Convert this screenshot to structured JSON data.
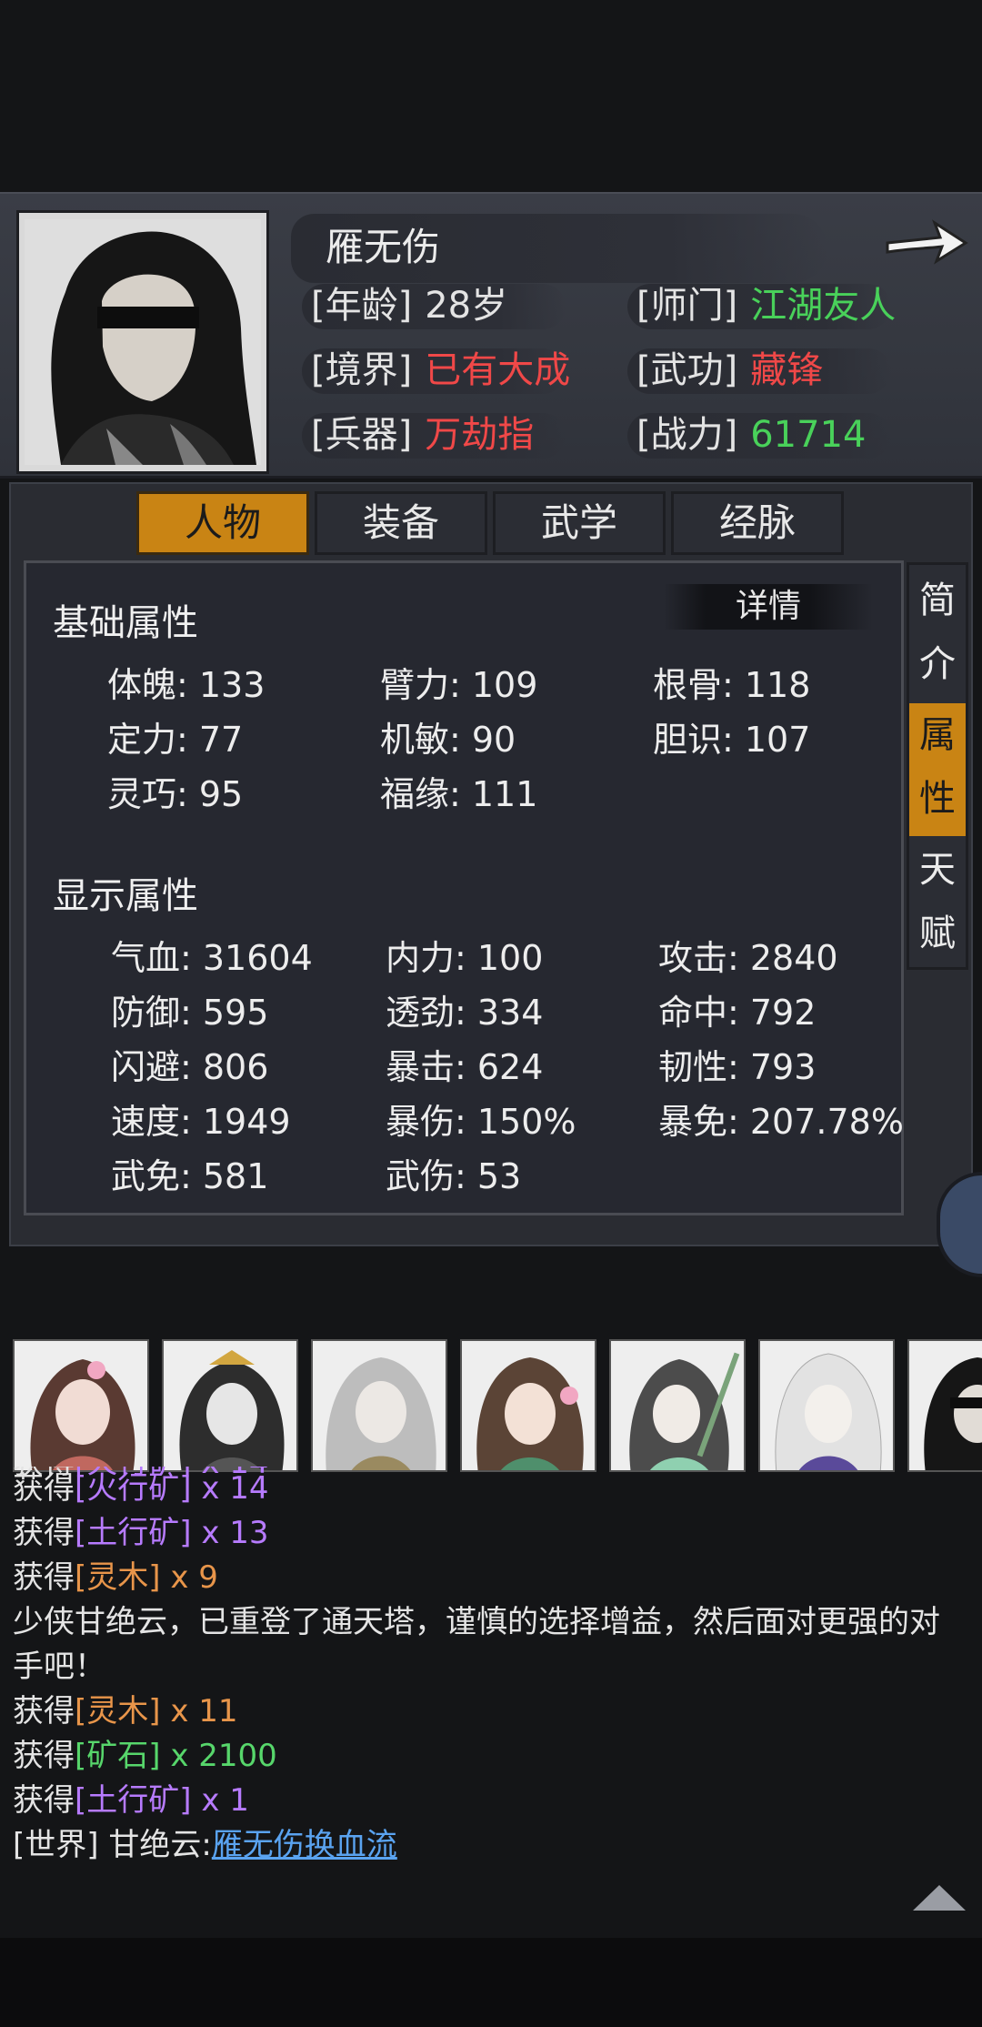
{
  "character": {
    "name": "雁无伤",
    "attributes": [
      {
        "key": "[年龄]",
        "value": "28岁",
        "color": "#e4e4e4"
      },
      {
        "key": "[师门]",
        "value": "江湖友人",
        "color": "#49d15a"
      },
      {
        "key": "[境界]",
        "value": "已有大成",
        "color": "#f04848"
      },
      {
        "key": "[武功]",
        "value": "藏锋",
        "color": "#f04848"
      },
      {
        "key": "[兵器]",
        "value": "万劫指",
        "color": "#f04848"
      },
      {
        "key": "[战力]",
        "value": "61714",
        "color": "#49d15a"
      }
    ]
  },
  "tabs": [
    "人物",
    "装备",
    "武学",
    "经脉"
  ],
  "active_tab": "人物",
  "side_tabs": [
    "简介",
    "属性",
    "天赋"
  ],
  "active_side_tab": "属性",
  "detail_button": "详情",
  "base_section": {
    "title": "基础属性",
    "stats": [
      "体魄: 133",
      "臂力: 109",
      "根骨: 118",
      "定力: 77",
      "机敏: 90",
      "胆识: 107",
      "灵巧: 95",
      "福缘: 111"
    ]
  },
  "display_section": {
    "title": "显示属性",
    "stats": [
      "气血: 31604",
      "内力: 100",
      "攻击: 2840",
      "防御: 595",
      "透劲: 334",
      "命中: 792",
      "闪避: 806",
      "暴击: 624",
      "韧性: 793",
      "速度: 1949",
      "暴伤: 150%",
      "暴免: 207.78%",
      "武免: 581",
      "武伤: 53"
    ]
  },
  "chat": [
    {
      "prefix": "获得",
      "item": "[火行矿]",
      "suffix": " x 14",
      "color": "purple"
    },
    {
      "prefix": "获得",
      "item": "[土行矿]",
      "suffix": " x 13",
      "color": "purple"
    },
    {
      "prefix": "获得",
      "item": "[灵木]",
      "suffix": " x 9",
      "color": "orange"
    },
    {
      "text": "少侠甘绝云，已重登了通天塔，谨慎的选择增益，然后面对更强的对手吧！"
    },
    {
      "prefix": "获得",
      "item": "[灵木]",
      "suffix": " x 11",
      "color": "orange"
    },
    {
      "prefix": "获得",
      "item": "[矿石]",
      "suffix": " x 2100",
      "color": "green"
    },
    {
      "prefix": "获得",
      "item": "[土行矿]",
      "suffix": " x 1",
      "color": "purple"
    }
  ],
  "chat_clipped_line": {
    "prefix": "获得",
    "item": "[火行矿]",
    "suffix": " x 14"
  },
  "world_message": {
    "channel": "[世界]",
    "sender": "甘绝云:",
    "link": "雁无伤换血流"
  }
}
